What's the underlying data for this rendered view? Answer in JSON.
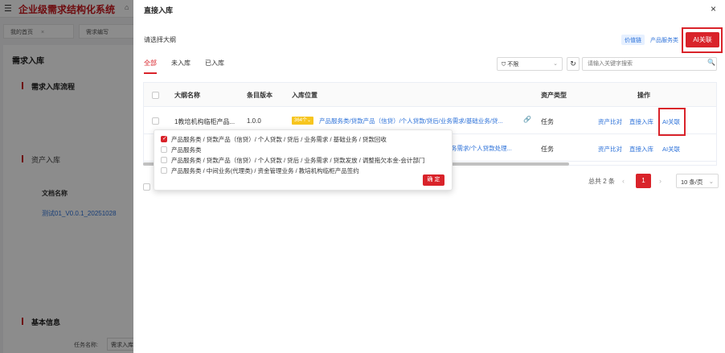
{
  "app": {
    "title": "企业级需求结构化系统",
    "tabs": [
      "我的首页",
      "需求编写"
    ],
    "page_heading": "需求入库",
    "sections": [
      "需求入库流程",
      "资产入库",
      "基本信息"
    ],
    "doc_table_header": "文档名称",
    "doc_link": "测试01_V0.0.1_20251028",
    "task_field_label": "任务名称:",
    "task_field_value": "需求入库"
  },
  "modal": {
    "title": "直接入库",
    "close_glyph": "×",
    "outline_label": "请选择大纲",
    "tag_value_chain": "价值链",
    "tag_product": "产品服务类",
    "ai_button": "AI关联",
    "tabs": [
      "全部",
      "未入库",
      "已入库"
    ],
    "filter": {
      "value": "不限",
      "icon": "⛉"
    },
    "refresh_glyph": "↻",
    "search": {
      "placeholder": "请输入关键字搜索"
    },
    "table": {
      "headers": [
        "大纲名称",
        "条目版本",
        "入库位置",
        "资产类型",
        "操作"
      ],
      "rows": [
        {
          "name": "1教培机构临柜产品...",
          "version": "1.0.0",
          "count_badge": "364个",
          "location": "产品服务类/贷款产品（信贷）/个人贷款/贷后/业务需求/基础业务/贷...",
          "asset_type": "任务",
          "ops": [
            "资产比对",
            "直接入库",
            "AI关联"
          ]
        },
        {
          "name": "",
          "version": "",
          "count_badge": "",
          "location": "务需求/个人贷款处理...",
          "asset_type": "任务",
          "ops": [
            "资产比对",
            "直接入库",
            "AI关联"
          ]
        }
      ]
    },
    "pagination": {
      "total": "总共 2 条",
      "current": "1",
      "page_size": "10 条/页"
    },
    "popover": {
      "items": [
        {
          "text": "产品服务类 / 贷款产品（信贷）/ 个人贷款 / 贷后 / 业务需求 / 基础业务 / 贷款回收",
          "checked": true
        },
        {
          "text": "产品服务类",
          "checked": false
        },
        {
          "text": "产品服务类 / 贷款产品（信贷）/ 个人贷款 / 贷后 / 业务需求 / 贷款发放 / 调整拖欠本金-会计部门",
          "checked": false
        },
        {
          "text": "产品服务类 / 中间业务(代理类) / 资金管理业务 / 教培机构临柜产品签约",
          "checked": false
        }
      ],
      "ok": "确 定"
    }
  }
}
